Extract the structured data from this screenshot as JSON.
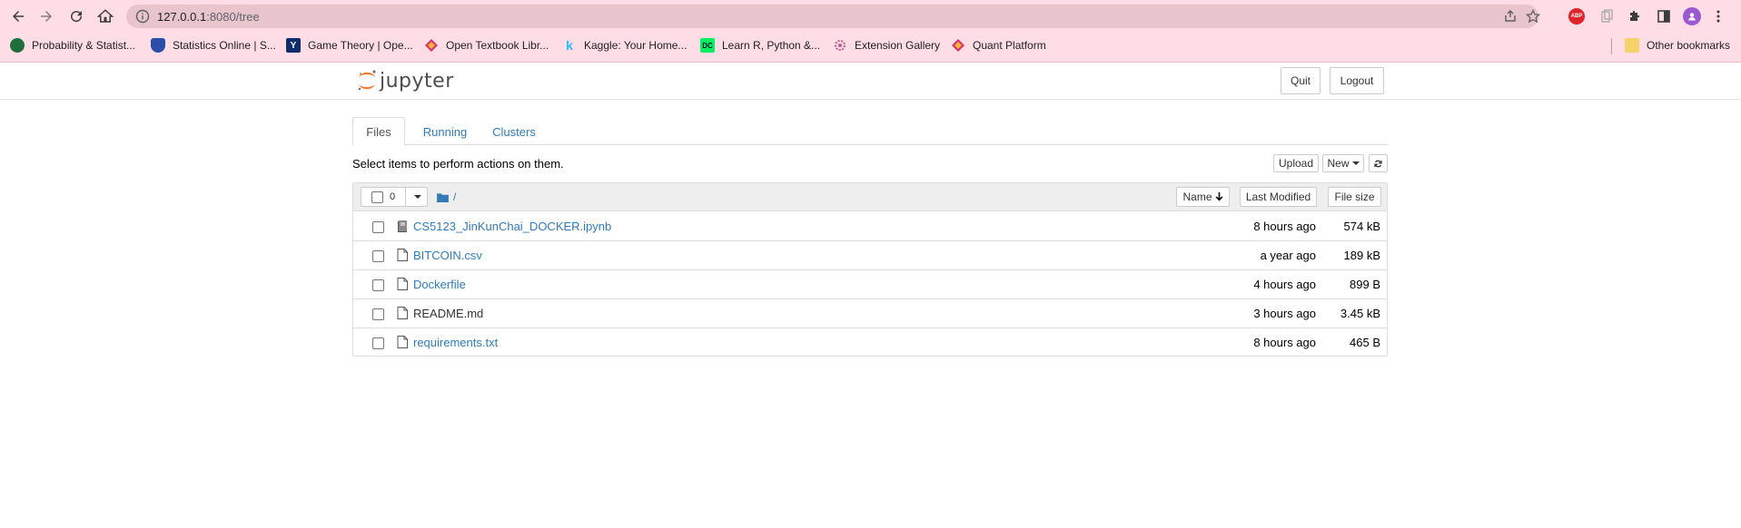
{
  "browser": {
    "url_host": "127.0.0.1",
    "url_path": ":8080/tree",
    "bookmarks": [
      {
        "label": "Probability & Statist...",
        "icon": "globe-icon"
      },
      {
        "label": "Statistics Online | S...",
        "icon": "shield-icon"
      },
      {
        "label": "Game Theory | Ope...",
        "icon": "yale-y-icon"
      },
      {
        "label": "Open Textbook Libr...",
        "icon": "diamond-icon"
      },
      {
        "label": "Kaggle: Your Home...",
        "icon": "kaggle-k-icon"
      },
      {
        "label": "Learn R, Python &...",
        "icon": "datacamp-icon"
      },
      {
        "label": "Extension Gallery",
        "icon": "gear-icon"
      },
      {
        "label": "Quant Platform",
        "icon": "diamond-icon"
      }
    ],
    "other_bookmarks": "Other bookmarks",
    "abp_label": "ABP"
  },
  "header": {
    "logo_text": "jupyter",
    "quit_label": "Quit",
    "logout_label": "Logout"
  },
  "tabs": [
    {
      "label": "Files",
      "active": true
    },
    {
      "label": "Running",
      "active": false
    },
    {
      "label": "Clusters",
      "active": false
    }
  ],
  "toolbar": {
    "hint": "Select items to perform actions on them.",
    "upload_label": "Upload",
    "new_label": "New"
  },
  "list_header": {
    "selected_count": "0",
    "path": "/",
    "name_label": "Name",
    "modified_label": "Last Modified",
    "size_label": "File size"
  },
  "files": [
    {
      "name": "CS5123_JinKunChai_DOCKER.ipynb",
      "modified": "8 hours ago",
      "size": "574 kB",
      "icon": "notebook-icon"
    },
    {
      "name": "BITCOIN.csv",
      "modified": "a year ago",
      "size": "189 kB",
      "icon": "file-icon"
    },
    {
      "name": "Dockerfile",
      "modified": "4 hours ago",
      "size": "899 B",
      "icon": "file-icon"
    },
    {
      "name": "README.md",
      "modified": "3 hours ago",
      "size": "3.45 kB",
      "icon": "file-icon"
    },
    {
      "name": "requirements.txt",
      "modified": "8 hours ago",
      "size": "465 B",
      "icon": "file-icon"
    }
  ],
  "colors": {
    "chrome_bg": "#ffdde6",
    "omnibox_bg": "#e8c4cd",
    "link": "#337ab7",
    "jupyter_orange": "#f37726"
  }
}
